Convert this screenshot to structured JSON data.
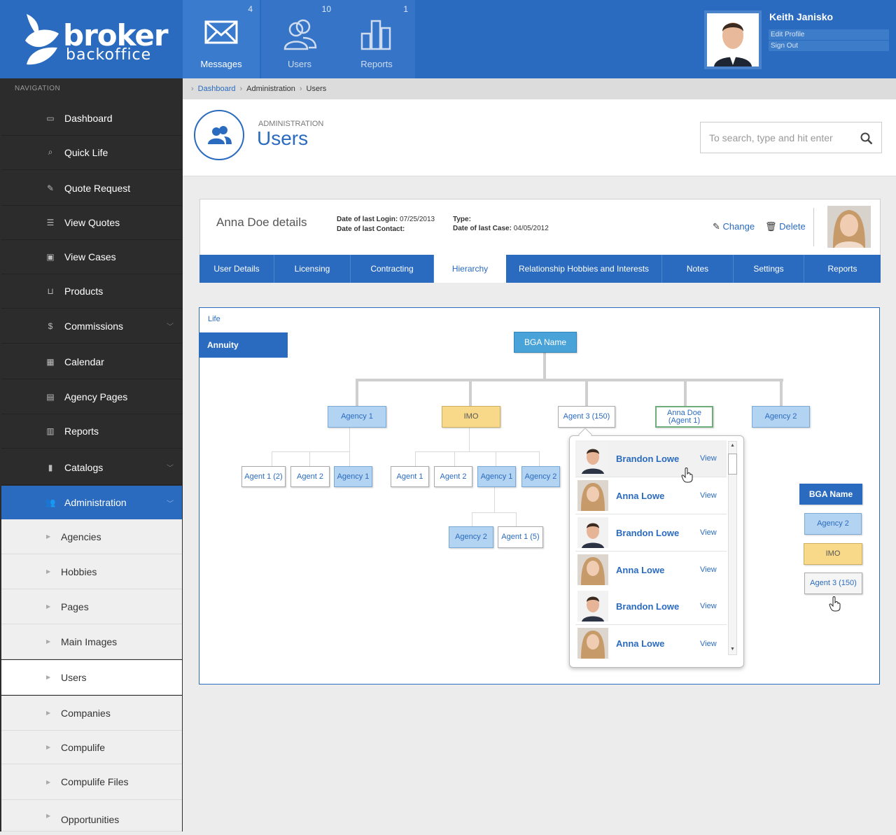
{
  "brand": {
    "word1": "broker",
    "word2": "backoffice"
  },
  "topnav": [
    {
      "label": "Messages",
      "count": "4",
      "icon": "envelope-icon"
    },
    {
      "label": "Users",
      "count": "10",
      "icon": "users-icon"
    },
    {
      "label": "Reports",
      "count": "1",
      "icon": "bar-chart-icon"
    }
  ],
  "profile": {
    "name": "Keith Janisko",
    "edit": "Edit Profile",
    "signout": "Sign Out"
  },
  "sidebar": {
    "nav_label": "NAVIGATION",
    "items": [
      {
        "label": "Dashboard",
        "icon": "laptop-icon",
        "glyph": "▭"
      },
      {
        "label": "Quick Life",
        "icon": "search-icon",
        "glyph": "⌕"
      },
      {
        "label": "Quote Request",
        "icon": "edit-icon",
        "glyph": "✎"
      },
      {
        "label": "View Quotes",
        "icon": "list-icon",
        "glyph": "☰"
      },
      {
        "label": "View Cases",
        "icon": "lock-icon",
        "glyph": "▣"
      },
      {
        "label": "Products",
        "icon": "cart-icon",
        "glyph": "⊔"
      },
      {
        "label": "Commissions",
        "icon": "dollar-icon",
        "glyph": "$"
      },
      {
        "label": "Calendar",
        "icon": "calendar-icon",
        "glyph": "▦"
      },
      {
        "label": "Agency Pages",
        "icon": "file-icon",
        "glyph": "▤"
      },
      {
        "label": "Reports",
        "icon": "bar-chart-icon",
        "glyph": "▥"
      },
      {
        "label": "Catalogs",
        "icon": "book-icon",
        "glyph": "▮"
      },
      {
        "label": "Administration",
        "icon": "users-icon",
        "glyph": "👥"
      }
    ],
    "subitems": [
      "Agencies",
      "Hobbies",
      "Pages",
      "Main Images",
      "Users",
      "Companies",
      "Compulife",
      "Compulife Files",
      "Opportunities"
    ]
  },
  "breadcrumb": [
    "Dashboard",
    "Administration",
    "Users"
  ],
  "page": {
    "section": "ADMINISTRATION",
    "title": "Users"
  },
  "search": {
    "placeholder": "To search, type and hit enter"
  },
  "details": {
    "title": "Anna Doe details",
    "last_login_label": "Date of last Login:",
    "last_login": "07/25/2013",
    "last_contact_label": "Date of last Contact:",
    "type_label": "Type:",
    "last_case_label": "Date of last Case:",
    "last_case": "04/05/2012",
    "change": "Change",
    "delete": "Delete"
  },
  "tabs": [
    "User Details",
    "Licensing",
    "Contracting",
    "Hierarchy",
    "Relationship Hobbies and Interests",
    "Notes",
    "Settings",
    "Reports"
  ],
  "hierarchy": {
    "life": "Life",
    "annuity": "Annuity",
    "root": "BGA Name",
    "level1": [
      "Agency 1",
      "IMO",
      "Agent 3 (150)",
      "Anna Doe (Agent 1)",
      "Agency 2"
    ],
    "agency1_children": [
      "Agent 1 (2)",
      "Agent 2",
      "Agency 1"
    ],
    "imo_children": [
      "Agent 1",
      "Agent 2",
      "Agency 1",
      "Agency 2"
    ],
    "imo_agency1_children": [
      "Agency 2",
      "Agent 1 (5)"
    ],
    "legend": [
      "BGA Name",
      "Agency 2",
      "IMO",
      "Agent 3 (150)"
    ]
  },
  "popup": {
    "view": "View",
    "rows": [
      "Brandon Lowe",
      "Anna Lowe",
      "Brandon Lowe",
      "Anna Lowe",
      "Brandon Lowe",
      "Anna Lowe"
    ]
  },
  "colors": {
    "primary": "#2a6bbf",
    "sidebar": "#2c2c2c",
    "node_blue": "#b3d3f2",
    "node_yellow": "#f8d98a",
    "bga": "#49a3d8"
  }
}
